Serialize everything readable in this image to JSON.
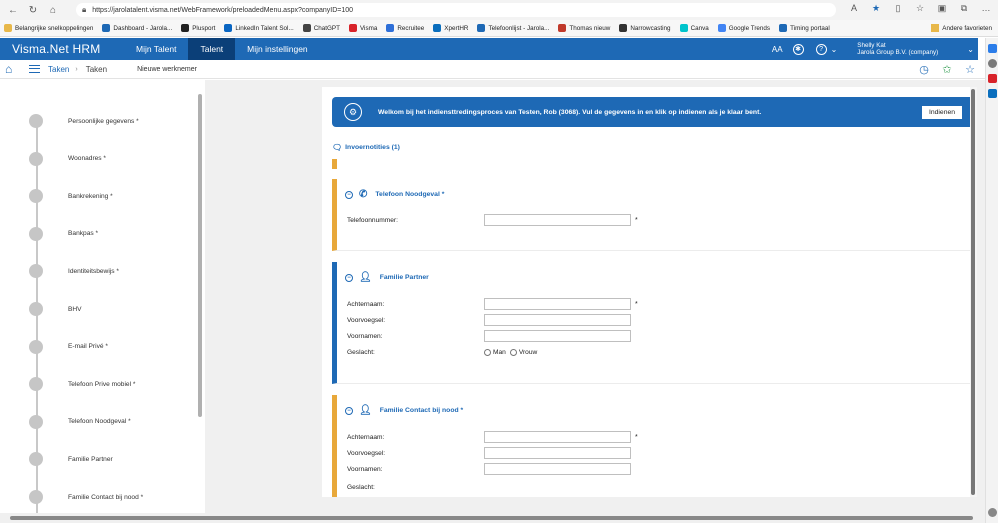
{
  "browser": {
    "url": "https://jarolatalent.visma.net/WebFramework/preloadedMenu.aspx?companyID=100",
    "bookmarks": [
      {
        "label": "Belangrijke snelkoppelingen",
        "color": "#e8b84a"
      },
      {
        "label": "Dashboard - Jarola...",
        "color": "#1e69b5"
      },
      {
        "label": "Plusport",
        "color": "#222222"
      },
      {
        "label": "LinkedIn Talent Sol...",
        "color": "#0a66c2"
      },
      {
        "label": "ChatGPT",
        "color": "#444444"
      },
      {
        "label": "Visma",
        "color": "#d8232a"
      },
      {
        "label": "Recruitee",
        "color": "#2e6fd8"
      },
      {
        "label": "XpertHR",
        "color": "#0a6ebd"
      },
      {
        "label": "Telefoonlijst - Jarola...",
        "color": "#1e69b5"
      },
      {
        "label": "Thomas nieuw",
        "color": "#c0392b"
      },
      {
        "label": "Narrowcasting",
        "color": "#333333"
      },
      {
        "label": "Canva",
        "color": "#00c4cc"
      },
      {
        "label": "Google Trends",
        "color": "#4285f4"
      },
      {
        "label": "Timing portaal",
        "color": "#1e69b5"
      }
    ],
    "other_favorites": "Andere favorieten"
  },
  "app": {
    "logo": "Visma.Net HRM",
    "tabs": [
      {
        "label": "Mijn Talent",
        "active": false
      },
      {
        "label": "Talent",
        "active": true
      },
      {
        "label": "Mijn instellingen",
        "active": false
      }
    ],
    "font_size_label": "AA",
    "user_name": "Shelly Kat",
    "company": "Jarola Group B.V. (company)"
  },
  "breadcrumb": {
    "items": [
      "Taken",
      "Taken"
    ],
    "sub": "Nieuwe werknemer"
  },
  "wizard": {
    "steps": [
      "Persoonlijke gegevens *",
      "Woonadres *",
      "Bankrekening *",
      "Bankpas *",
      "Identiteitsbewijs *",
      "BHV",
      "E-mail Privé *",
      "Telefoon Prive mobiel *",
      "Telefoon Noodgeval *",
      "Familie Partner",
      "Familie Contact bij nood *"
    ]
  },
  "welcome": {
    "text": "Welkom bij het indiensttredingsproces van Testen, Rob (3068). Vul de gegevens in en klik op indienen als je klaar bent.",
    "submit": "Indienen"
  },
  "notes": {
    "label": "Invoernotities (1)"
  },
  "sections": {
    "noodgeval": {
      "title": "Telefoon Noodgeval *",
      "phone_label": "Telefoonnummer:",
      "required": "*"
    },
    "partner": {
      "title": "Familie Partner",
      "achternaam": "Achternaam:",
      "voorvoegsel": "Voorvoegsel:",
      "voornamen": "Voornamen:",
      "geslacht": "Geslacht:",
      "man": "Man",
      "vrouw": "Vrouw",
      "required": "*"
    },
    "contact": {
      "title": "Familie Contact bij nood *",
      "achternaam": "Achternaam:",
      "voorvoegsel": "Voorvoegsel:",
      "voornamen": "Voornamen:",
      "geslacht": "Geslacht:",
      "required": "*"
    }
  },
  "colors": {
    "brand_blue": "#1e69b5",
    "active_tab": "#0b3f78",
    "accent_orange": "#e8a83a"
  }
}
